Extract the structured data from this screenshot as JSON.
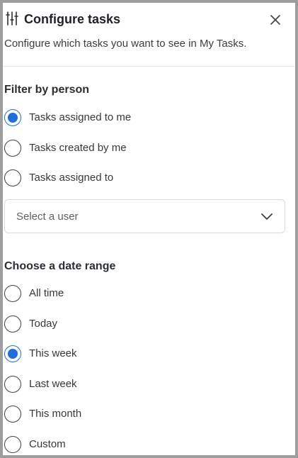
{
  "header": {
    "icon": "sliders-icon",
    "title": "Configure tasks",
    "close_icon": "close-icon"
  },
  "subtitle": "Configure which tasks you want to see in My Tasks.",
  "filter_by_person": {
    "title": "Filter by person",
    "options": [
      {
        "label": "Tasks assigned to me",
        "checked": true
      },
      {
        "label": "Tasks created by me",
        "checked": false
      },
      {
        "label": "Tasks assigned to",
        "checked": false
      }
    ],
    "user_select": {
      "placeholder": "Select a user",
      "icon": "chevron-down-icon"
    }
  },
  "date_range": {
    "title": "Choose a date range",
    "options": [
      {
        "label": "All time",
        "checked": false
      },
      {
        "label": "Today",
        "checked": false
      },
      {
        "label": "This week",
        "checked": true
      },
      {
        "label": "Last week",
        "checked": false
      },
      {
        "label": "This month",
        "checked": false
      },
      {
        "label": "Custom",
        "checked": false
      }
    ]
  },
  "colors": {
    "accent": "#1e6fd9",
    "text": "#2f3337",
    "border": "#d9dbde",
    "frame": "#9e9e9e"
  }
}
